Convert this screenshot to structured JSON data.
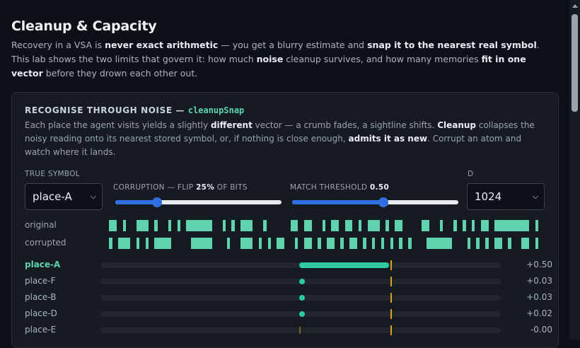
{
  "header": {
    "title": "Cleanup & Capacity",
    "intro": [
      {
        "t": "Recovery in a VSA is "
      },
      {
        "t": "never exact arithmetic",
        "b": true
      },
      {
        "t": " — you get a blurry estimate and "
      },
      {
        "t": "snap it to the nearest real symbol",
        "b": true
      },
      {
        "t": ". This lab shows the two limits that govern it: how much "
      },
      {
        "t": "noise",
        "b": true
      },
      {
        "t": " cleanup survives, and how many memories "
      },
      {
        "t": "fit in one vector",
        "b": true
      },
      {
        "t": " before they drown each other out."
      }
    ]
  },
  "card": {
    "heading": "RECOGNISE THROUGH NOISE",
    "heading_sep": " — ",
    "heading_code": "cleanupSnap",
    "description": [
      {
        "t": "Each place the agent visits yields a slightly "
      },
      {
        "t": "different",
        "b": true
      },
      {
        "t": " vector — a crumb fades, a sightline shifts. "
      },
      {
        "t": "Cleanup",
        "b": true
      },
      {
        "t": " collapses the noisy reading onto its nearest stored symbol, or, if nothing is close enough, "
      },
      {
        "t": "admits it as new",
        "b": true
      },
      {
        "t": ". Corrupt an atom and watch where it lands."
      }
    ]
  },
  "controls": {
    "true_symbol_label": "TRUE SYMBOL",
    "true_symbol_value": "place-A",
    "corruption_label_pre": "CORRUPTION — FLIP ",
    "corruption_pct": "25%",
    "corruption_label_post": " OF BITS",
    "corruption_fraction": 0.25,
    "threshold_label": "MATCH THRESHOLD ",
    "threshold_value": "0.50",
    "threshold_fraction": 0.55,
    "d_label": "D",
    "d_value": "1024"
  },
  "bits": {
    "original_label": "original",
    "corrupted_label": "corrupted",
    "original": "011010011101001010111111001010111001000001101100101101101011101011000011001001010101101111111101",
    "corrupted": "010111010101111000011111000100111010101100101101011010110101010101010001111110001010101101001101"
  },
  "matches": [
    {
      "name": "place-A",
      "value": "+0.50",
      "score": 0.5,
      "best": true
    },
    {
      "name": "place-F",
      "value": "+0.03",
      "score": 0.03,
      "best": false
    },
    {
      "name": "place-B",
      "value": "+0.03",
      "score": 0.03,
      "best": false
    },
    {
      "name": "place-D",
      "value": "+0.02",
      "score": 0.02,
      "best": false
    },
    {
      "name": "place-E",
      "value": "-0.00",
      "score": 0.0,
      "best": false
    }
  ],
  "colors": {
    "accent": "#5fd3ad",
    "bar": "#2dc9a0",
    "slider": "#2f6fe4",
    "threshold": "#d9a21b"
  },
  "icons": {
    "select_chevron": "chevron-down-icon"
  }
}
